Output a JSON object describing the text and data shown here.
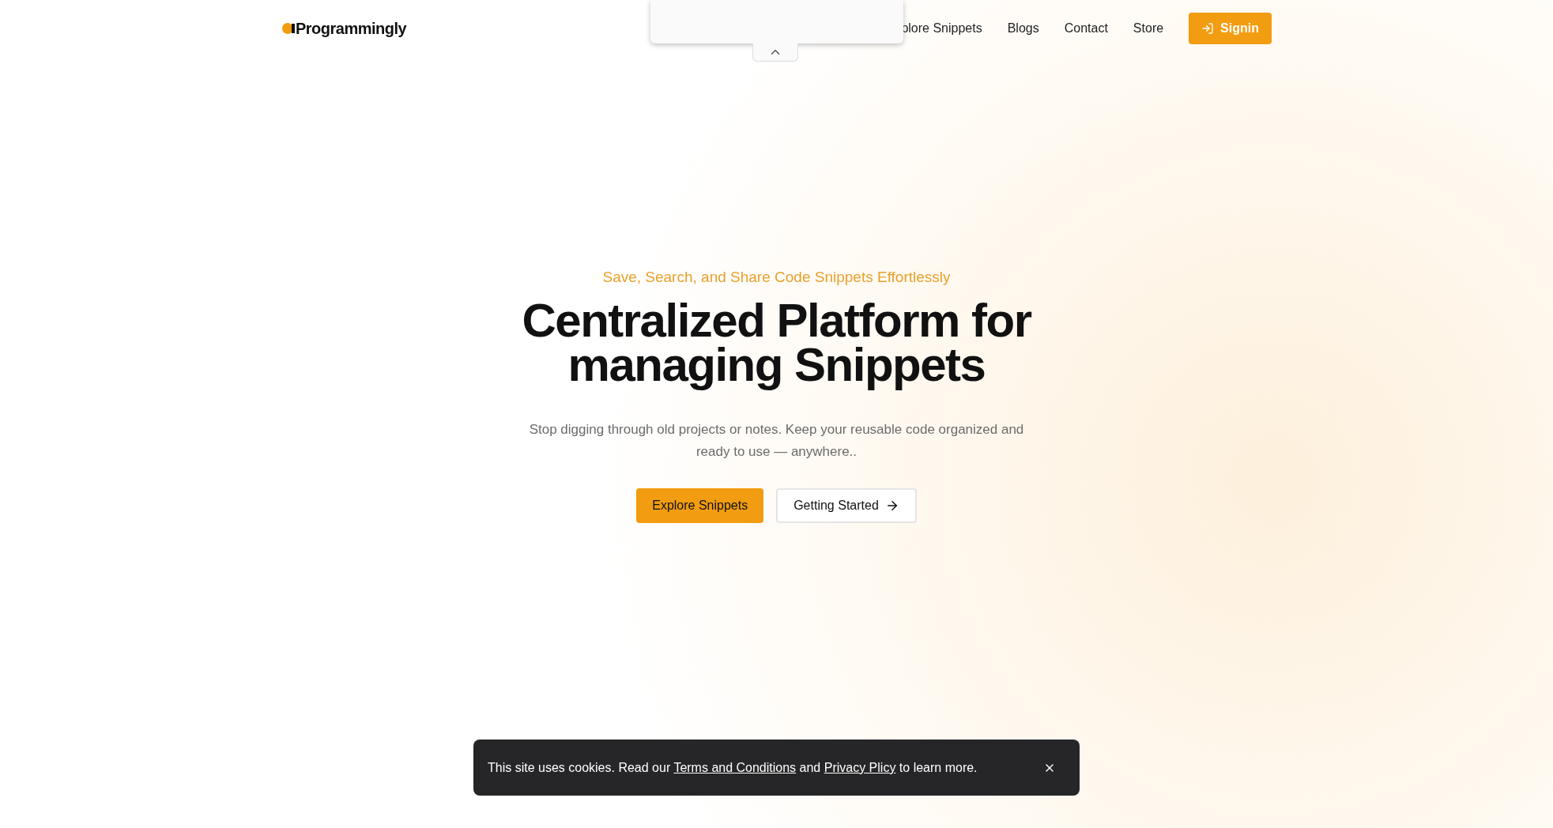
{
  "header": {
    "logo": "Programmingly",
    "nav": [
      {
        "label": "plore Snippets"
      },
      {
        "label": "Blogs"
      },
      {
        "label": "Contact"
      },
      {
        "label": "Store"
      }
    ],
    "signin": "Signin"
  },
  "hero": {
    "tagline": "Save, Search, and Share Code Snippets Effortlessly",
    "title_lines": [
      "Centralized Platform for",
      "managing Snippets"
    ],
    "description": "Stop digging through old projects or notes. Keep your reusable code organized and ready to use — anywhere..",
    "buttons": [
      {
        "kind": "primary",
        "label": "Explore Snippets"
      },
      {
        "kind": "outline",
        "label": "Getting Started"
      }
    ]
  },
  "cookie_banner": {
    "before": "This site uses cookies. Read our ",
    "link_1": "Terms and Conditions",
    "middle": " and ",
    "link_2": "Privacy Plicy",
    "after": " to learn more."
  }
}
